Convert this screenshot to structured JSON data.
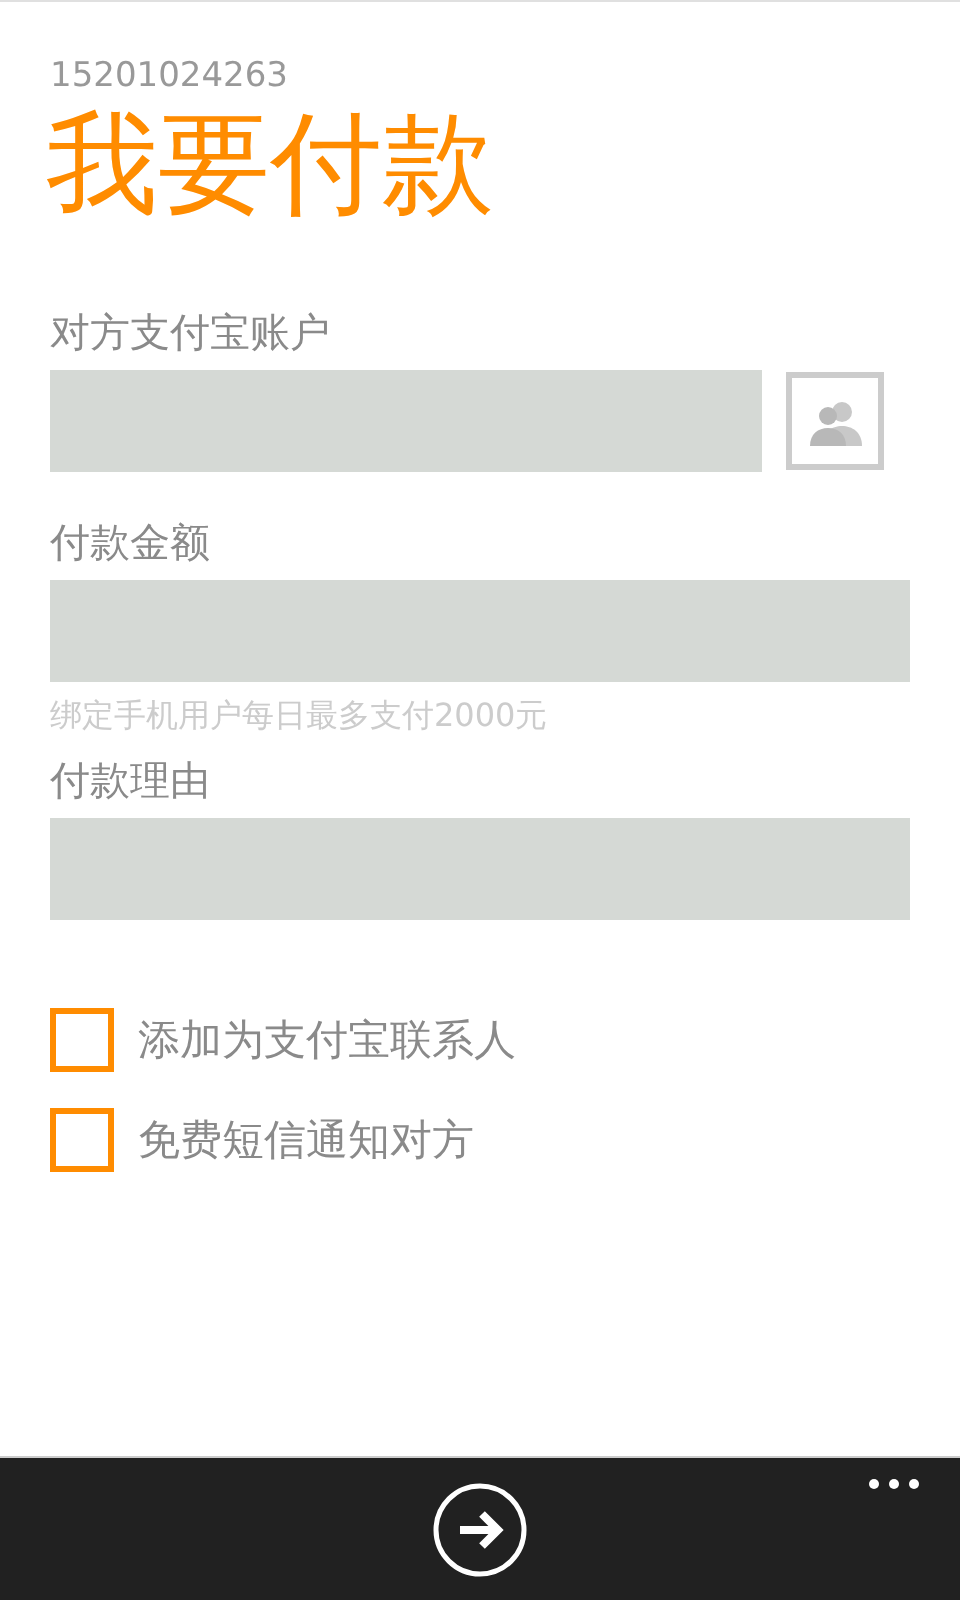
{
  "account": "15201024263",
  "title": "我要付款",
  "fields": [
    {
      "kind": "contact",
      "label": "对方支付宝账户"
    },
    {
      "kind": "plain",
      "label": "付款金额",
      "hint": "绑定手机用户每日最多支付2000元"
    },
    {
      "kind": "plain",
      "label": "付款理由"
    }
  ],
  "options": [
    {
      "label": "添加为支付宝联系人",
      "checked": false
    },
    {
      "label": "免费短信通知对方",
      "checked": false
    }
  ]
}
